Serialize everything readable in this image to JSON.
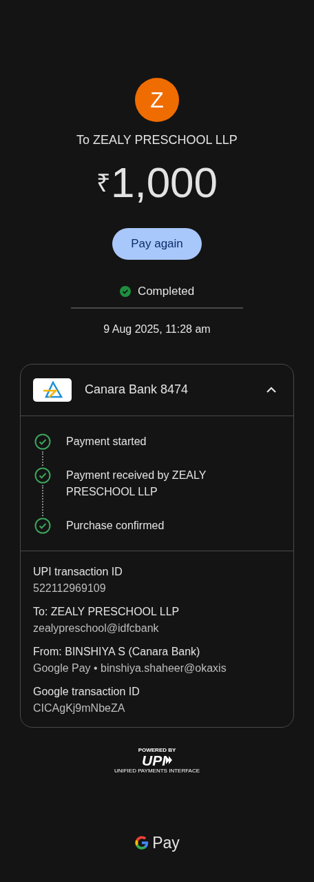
{
  "payee": {
    "initial": "Z",
    "title": "To ZEALY PRESCHOOL LLP"
  },
  "amount": {
    "currency": "₹",
    "value": "1,000"
  },
  "pay_again_button": "Pay again",
  "status": {
    "label": "Completed",
    "done": true
  },
  "datetime": "9 Aug 2025, 11:28 am",
  "account_card": {
    "bank": "Canara Bank 8474",
    "expanded": true,
    "steps": [
      {
        "label": "Payment started",
        "done": true
      },
      {
        "label": "Payment received by ZEALY PRESCHOOL LLP",
        "done": true
      },
      {
        "label": "Purchase confirmed",
        "done": true
      }
    ],
    "details": [
      {
        "label": "UPI transaction ID",
        "value": "522112969109"
      },
      {
        "label": "To: ZEALY PRESCHOOL LLP",
        "value": "zealypreschool@idfcbank"
      },
      {
        "label": "From: BINSHIYA S (Canara Bank)",
        "value": "Google Pay • binshiya.shaheer@okaxis"
      },
      {
        "label": "Google transaction ID",
        "value": "CICAgKj9mNbeZA"
      }
    ]
  },
  "upi_logo": {
    "powered_by": "POWERED BY",
    "mark": "UPI",
    "tagline": "UNIFIED PAYMENTS INTERFACE"
  },
  "footer_brand": "Pay"
}
